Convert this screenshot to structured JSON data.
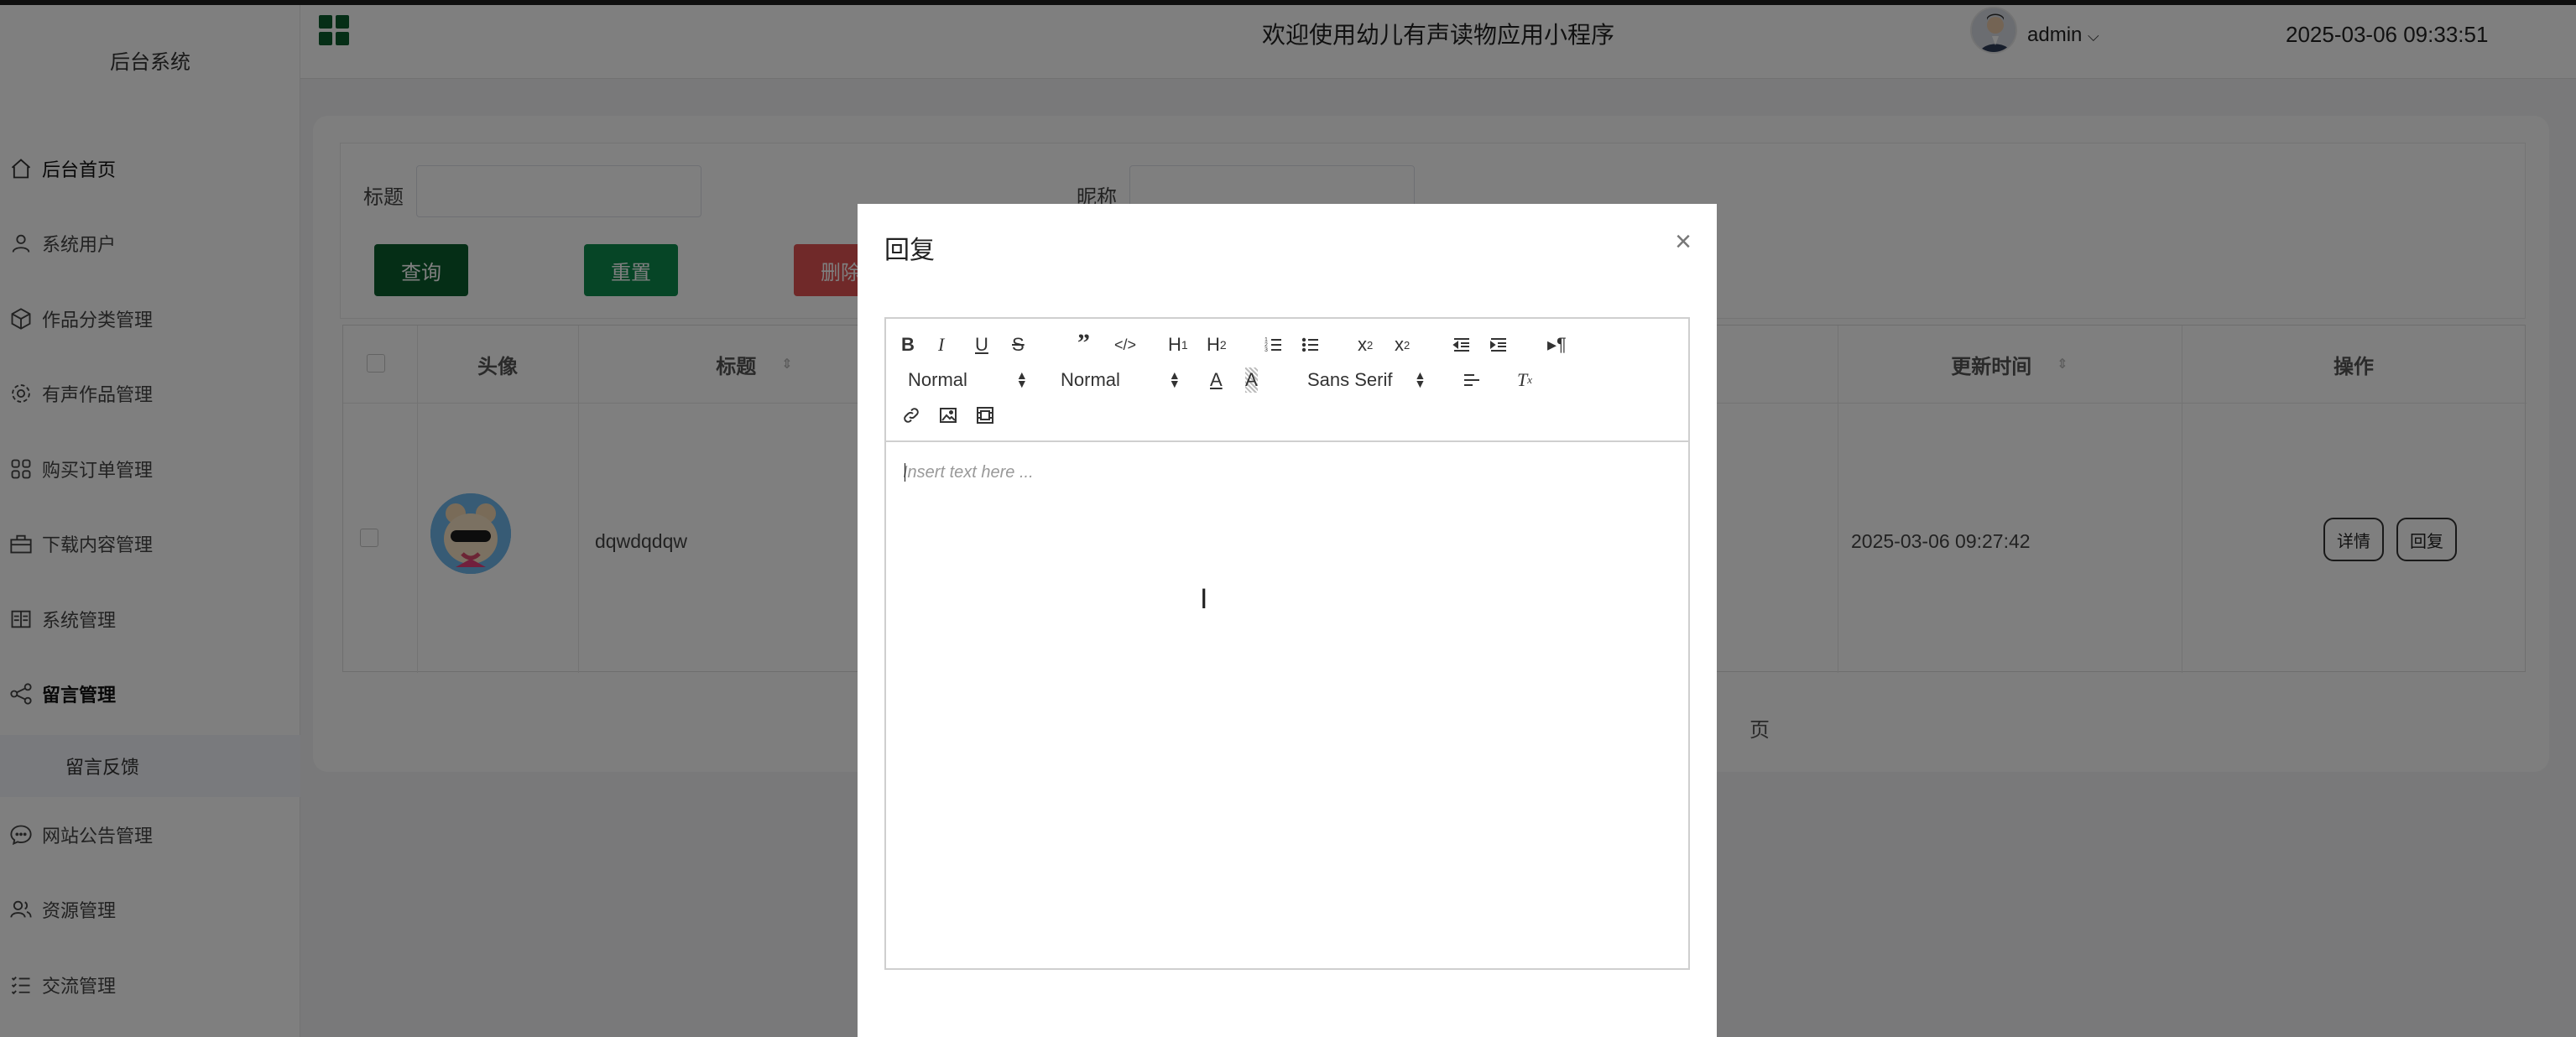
{
  "sidebar": {
    "title": "后台系统",
    "items": [
      {
        "label": "后台首页",
        "icon": "home-icon"
      },
      {
        "label": "系统用户",
        "icon": "user-icon"
      },
      {
        "label": "作品分类管理",
        "icon": "cube-icon"
      },
      {
        "label": "有声作品管理",
        "icon": "gear-icon"
      },
      {
        "label": "购买订单管理",
        "icon": "grid-icon"
      },
      {
        "label": "下载内容管理",
        "icon": "briefcase-icon"
      },
      {
        "label": "系统管理",
        "icon": "book-icon"
      },
      {
        "label": "留言管理",
        "icon": "share-icon"
      },
      {
        "label": "网站公告管理",
        "icon": "chat-icon"
      },
      {
        "label": "资源管理",
        "icon": "users-icon"
      },
      {
        "label": "交流管理",
        "icon": "list-icon"
      }
    ],
    "submenu": {
      "label": "留言反馈"
    }
  },
  "header": {
    "welcome": "欢迎使用幼儿有声读物应用小程序",
    "user": "admin",
    "datetime": "2025-03-06 09:33:51"
  },
  "search": {
    "title_label": "标题",
    "nickname_label": "昵称",
    "query_button": "查询",
    "reset_button": "重置",
    "delete_button": "删除"
  },
  "table": {
    "headers": {
      "avatar": "头像",
      "title": "标题",
      "updated": "更新时间",
      "actions": "操作"
    },
    "rows": [
      {
        "title": "dqwdqdqw",
        "updated": "2025-03-06 09:27:42",
        "detail_button": "详情",
        "reply_button": "回复"
      }
    ]
  },
  "pagination": {
    "page_word": "页"
  },
  "dialog": {
    "title": "回复",
    "close": "×",
    "editor": {
      "placeholder": "Insert text here ...",
      "header_picker": "Normal",
      "size_picker": "Normal",
      "font_picker": "Sans Serif"
    }
  },
  "colors": {
    "query": "#0a5c2c",
    "reset": "#0d8a4d",
    "delete": "#e05353",
    "accent": "#0a5c2c"
  }
}
